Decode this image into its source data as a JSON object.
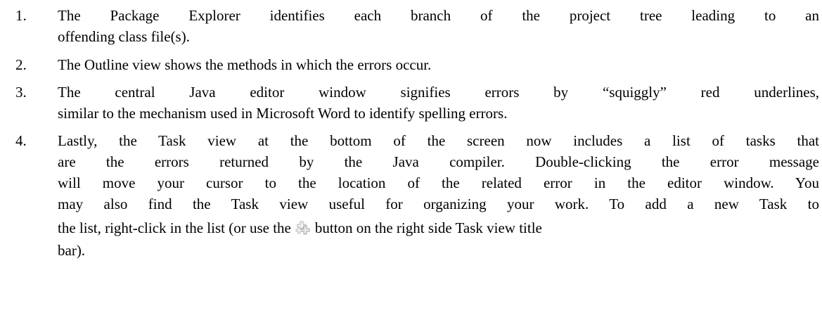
{
  "items": [
    {
      "number": "1.",
      "lines": [
        "The Package Explorer identifies each branch of the project tree leading to an",
        "offending class file(s)."
      ]
    },
    {
      "number": "2.",
      "lines": [
        "The Outline view shows the methods in which the errors occur."
      ]
    },
    {
      "number": "3.",
      "lines": [
        "The central Java editor window signifies errors by “squiggly” red underlines,",
        "similar to the mechanism used in Microsoft Word to identify spelling errors."
      ]
    },
    {
      "number": "4.",
      "lines": [
        "Lastly, the Task view at the bottom of the screen now includes a list of tasks that",
        "are the errors returned by the Java compiler.  Double-clicking the error message",
        "will move your cursor to the location of the related error in the editor window.  You",
        "may also find the Task view useful for organizing your work.  To add a new Task to"
      ],
      "last_line_before_icon": "the list, right-click in the list (or use the",
      "icon": "add-task-icon",
      "last_line_after_icon": "button on the right side Task view title",
      "final_line": "bar)."
    }
  ]
}
